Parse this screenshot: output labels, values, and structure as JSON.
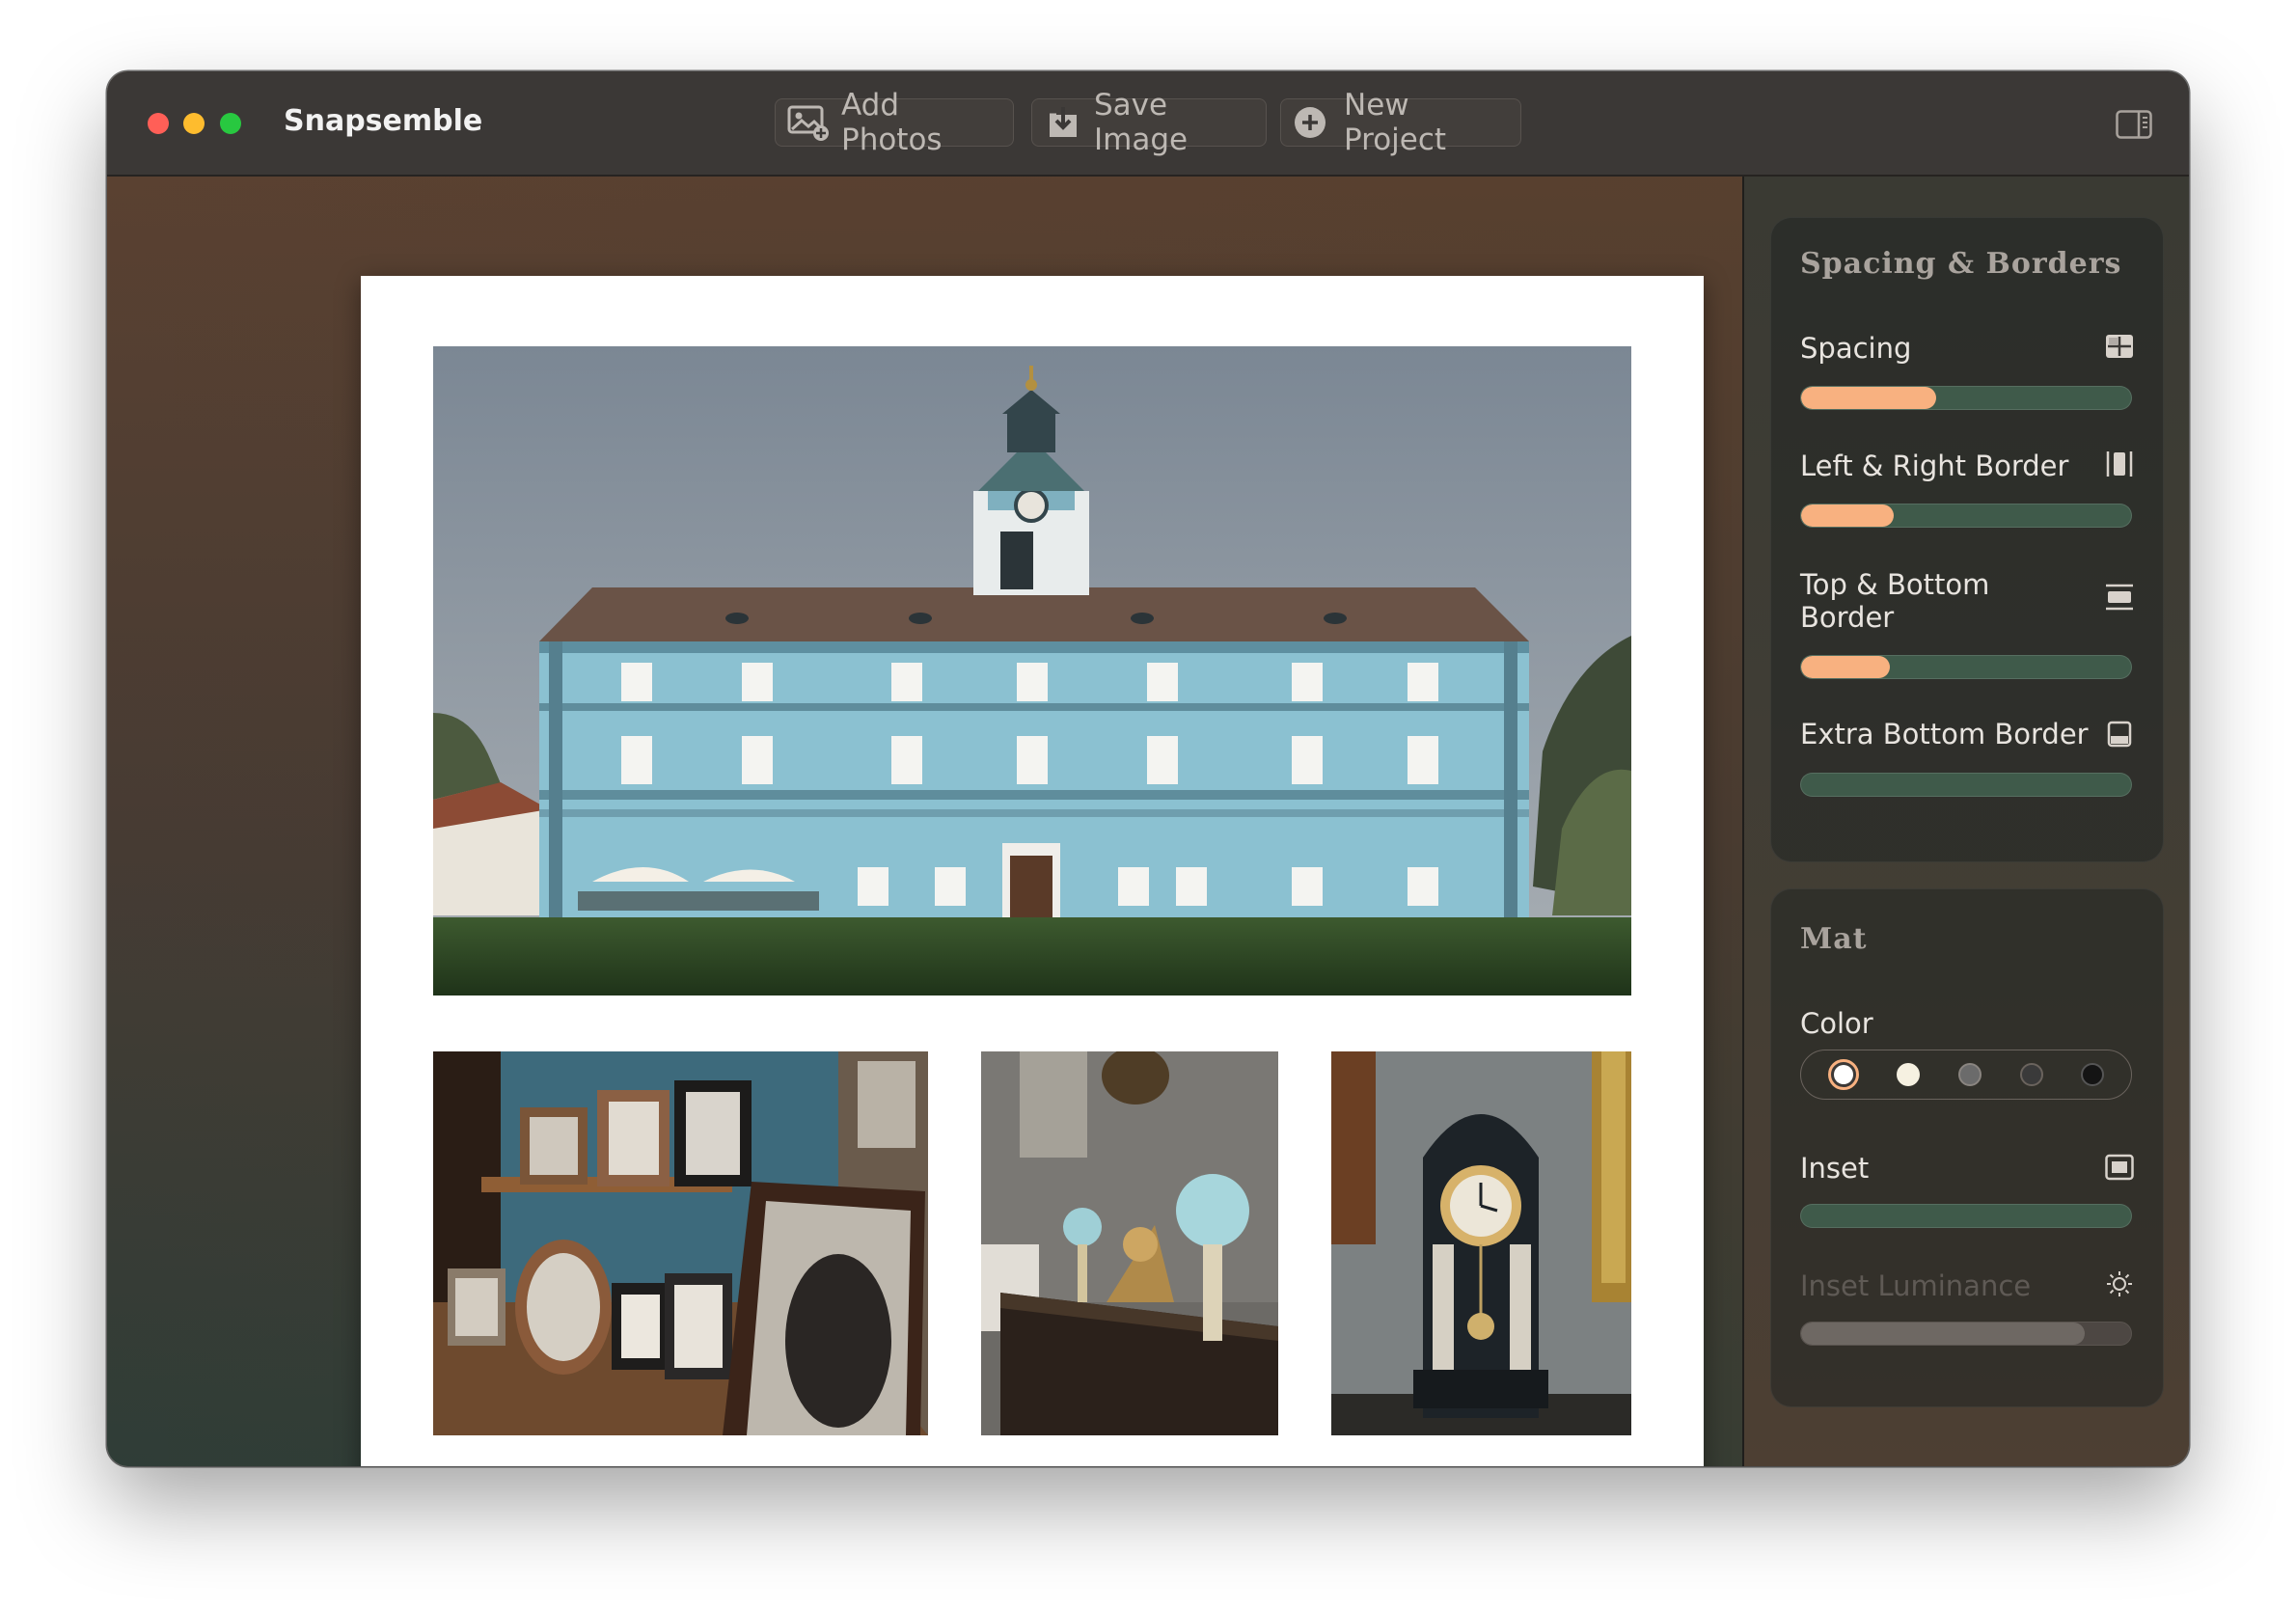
{
  "app": {
    "title": "Snapsemble"
  },
  "toolbar": {
    "add_photos": "Add Photos",
    "save_image": "Save Image",
    "new_project": "New Project"
  },
  "spacing_panel": {
    "title": "Spacing & Borders",
    "controls": [
      {
        "label": "Spacing",
        "icon": "grid-icon",
        "value_fraction": 0.41
      },
      {
        "label": "Left & Right Border",
        "icon": "vertical-borders-icon",
        "value_fraction": 0.28
      },
      {
        "label": "Top & Bottom Border",
        "icon": "horizontal-borders-icon",
        "value_fraction": 0.27
      },
      {
        "label": "Extra Bottom Border",
        "icon": "bottom-border-icon",
        "value_fraction": 0.0
      }
    ]
  },
  "mat_panel": {
    "title": "Mat",
    "color_label": "Color",
    "colors": [
      "#ffffff",
      "#f6f1e1",
      "#6b6b6b",
      "#3a3a3a",
      "#141414"
    ],
    "selected_color_index": 0,
    "inset_label": "Inset",
    "inset_value_fraction": 0.0,
    "inset_luminance_label": "Inset Luminance",
    "inset_luminance_value_fraction": 0.86
  },
  "colors": {
    "accent": "#f8b180",
    "track": "#3f5a4a"
  }
}
